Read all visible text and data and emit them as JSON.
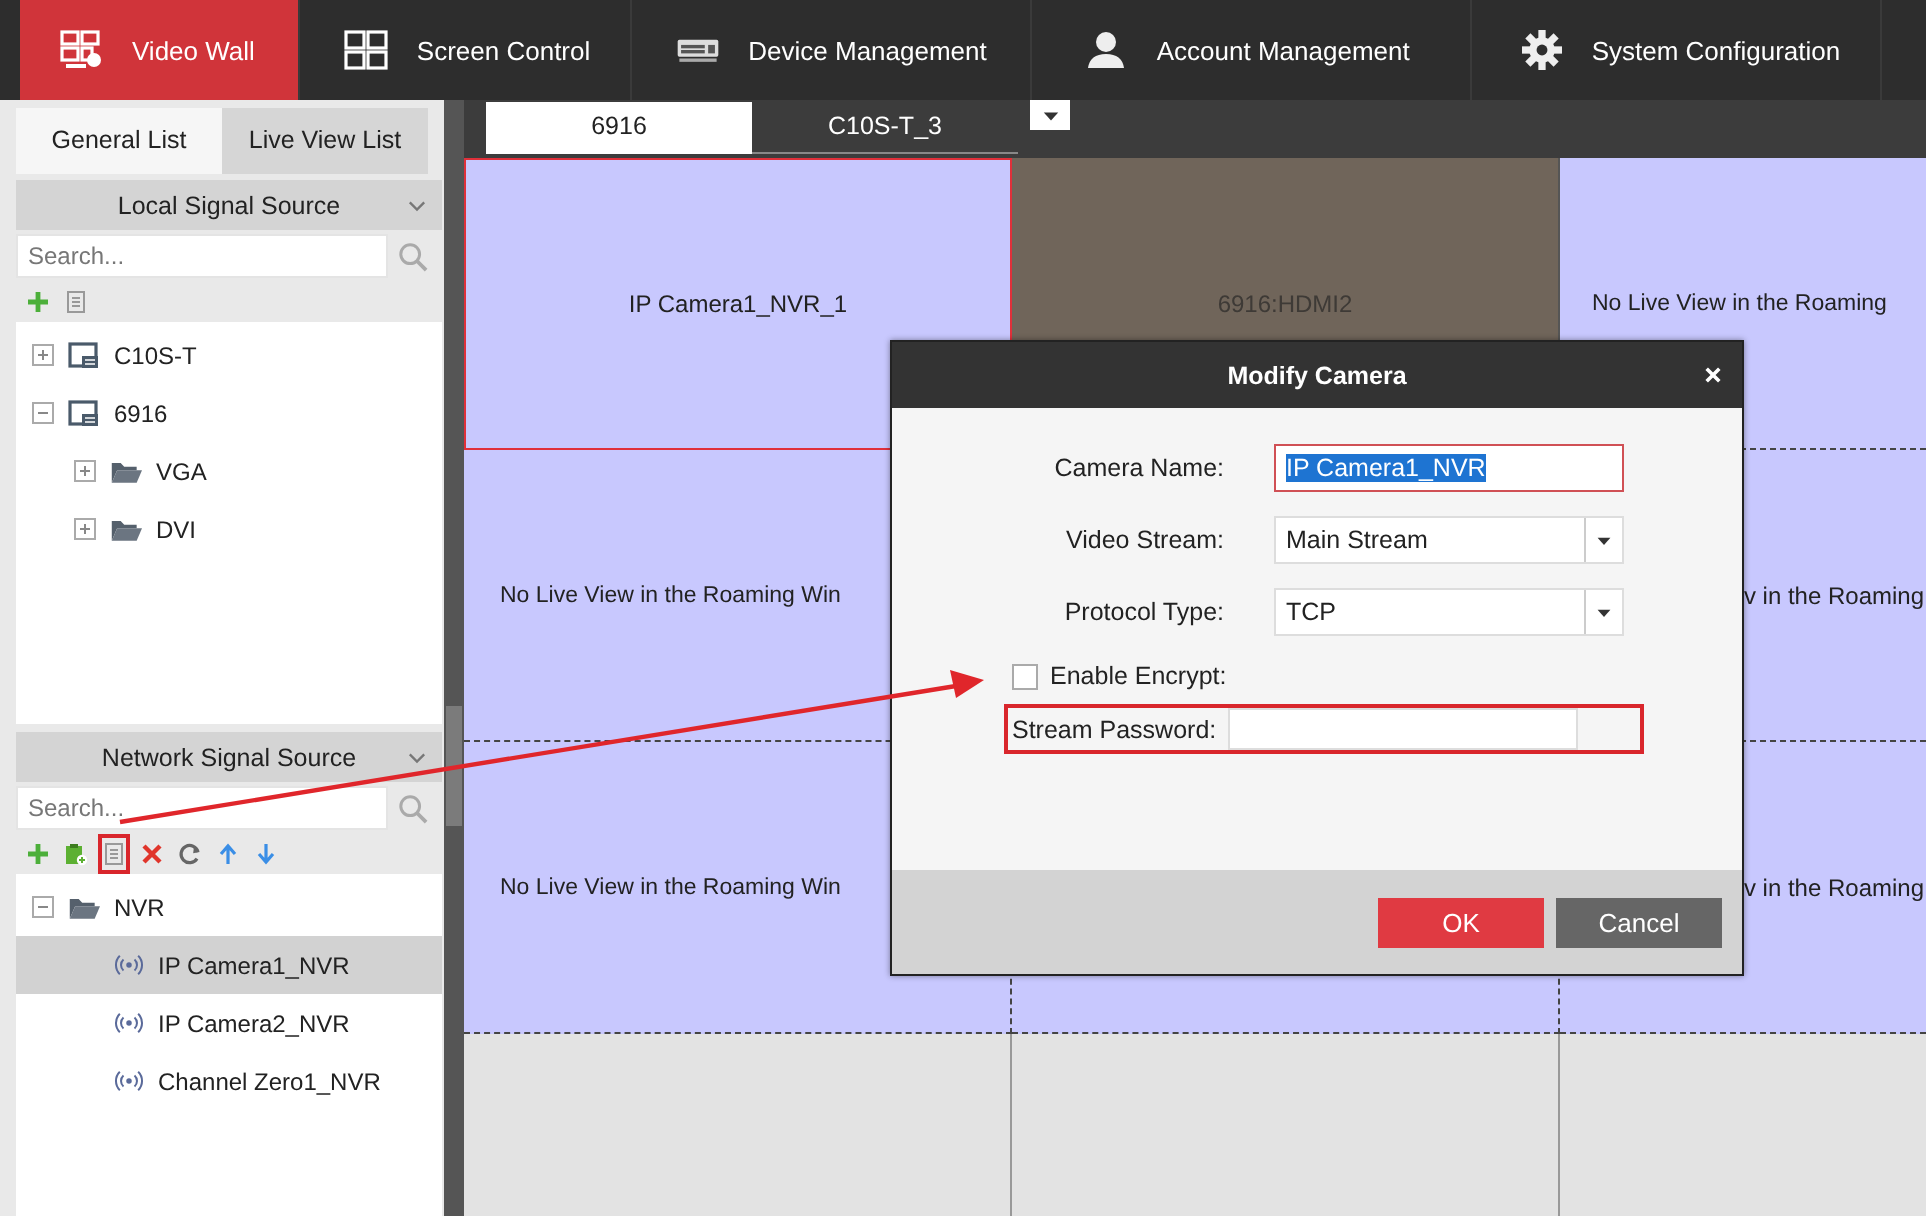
{
  "nav": [
    {
      "label": "Video Wall",
      "selected": true
    },
    {
      "label": "Screen Control",
      "selected": false
    },
    {
      "label": "Device Management",
      "selected": false
    },
    {
      "label": "Account Management",
      "selected": false
    },
    {
      "label": "System Configuration",
      "selected": false
    }
  ],
  "left_tabs": [
    {
      "label": "General List",
      "selected": true
    },
    {
      "label": "Live View List",
      "selected": false
    }
  ],
  "local_source": {
    "title": "Local Signal Source",
    "search": {
      "placeholder": "Search..."
    },
    "tools": [
      {
        "kind": "add",
        "highlighted": false
      },
      {
        "kind": "list",
        "highlighted": false
      }
    ],
    "tree": [
      {
        "label": "C10S-T",
        "kind": "device",
        "expanded": false,
        "selected": false
      },
      {
        "label": "6916",
        "kind": "device",
        "expanded": true,
        "selected": false,
        "children": [
          {
            "label": "VGA",
            "kind": "folder",
            "expanded": false,
            "selected": false
          },
          {
            "label": "DVI",
            "kind": "folder",
            "expanded": false,
            "selected": false
          }
        ]
      }
    ]
  },
  "network_source": {
    "title": "Network Signal Source",
    "search": {
      "placeholder": "Search..."
    },
    "tools": [
      {
        "kind": "add",
        "highlighted": false
      },
      {
        "kind": "add_device",
        "highlighted": false
      },
      {
        "kind": "list",
        "highlighted": true
      },
      {
        "kind": "delete",
        "highlighted": false
      },
      {
        "kind": "refresh",
        "highlighted": false
      },
      {
        "kind": "up",
        "highlighted": false
      },
      {
        "kind": "down",
        "highlighted": false
      }
    ],
    "tree": [
      {
        "label": "NVR",
        "kind": "folder",
        "expanded": true,
        "selected": false,
        "children": [
          {
            "label": "IP Camera1_NVR",
            "kind": "camera",
            "selected": true
          },
          {
            "label": "IP Camera2_NVR",
            "kind": "camera",
            "selected": false
          },
          {
            "label": "Channel Zero1_NVR",
            "kind": "camera",
            "selected": false
          }
        ]
      }
    ]
  },
  "wall_tabs": [
    {
      "label": "6916",
      "selected": true
    },
    {
      "label": "C10S-T_3",
      "selected": false
    }
  ],
  "wall": {
    "rows": [
      [
        {
          "text": "IP Camera1_NVR_1",
          "kind": "window",
          "selected": true
        },
        {
          "text": "6916:HDMI2",
          "kind": "signal",
          "selected": false
        },
        {
          "text": "No Live View in the Roaming",
          "kind": "window",
          "selected": false
        }
      ],
      [
        {
          "text": "No Live View in the Roaming Win",
          "kind": "window",
          "selected": false
        },
        {
          "kind": "covered"
        },
        {
          "text": "v in the Roaming",
          "kind": "window",
          "selected": false
        }
      ],
      [
        {
          "text": "No Live View in the Roaming Win",
          "kind": "window",
          "selected": false
        },
        {
          "kind": "window"
        },
        {
          "text": "v in the Roaming",
          "kind": "window",
          "selected": false
        }
      ],
      [
        {
          "kind": "blank",
          "selected": false
        },
        {
          "kind": "blank",
          "selected": false
        },
        {
          "kind": "blank",
          "selected": false
        }
      ]
    ]
  },
  "dialog": {
    "title": "Modify Camera",
    "fields": [
      {
        "kind": "text",
        "label": "Camera Name:",
        "value": "IP Camera1_NVR",
        "focused": true
      },
      {
        "kind": "select",
        "label": "Video Stream:",
        "value": "Main Stream"
      },
      {
        "kind": "select",
        "label": "Protocol Type:",
        "value": "TCP"
      },
      {
        "kind": "checkbox",
        "label": "Enable Encrypt:",
        "checked": false
      },
      {
        "kind": "password",
        "label": "Stream Password:",
        "highlighted": true
      }
    ],
    "buttons": [
      {
        "label": "OK",
        "kind": "primary"
      },
      {
        "label": "Cancel",
        "kind": "secondary"
      }
    ]
  }
}
